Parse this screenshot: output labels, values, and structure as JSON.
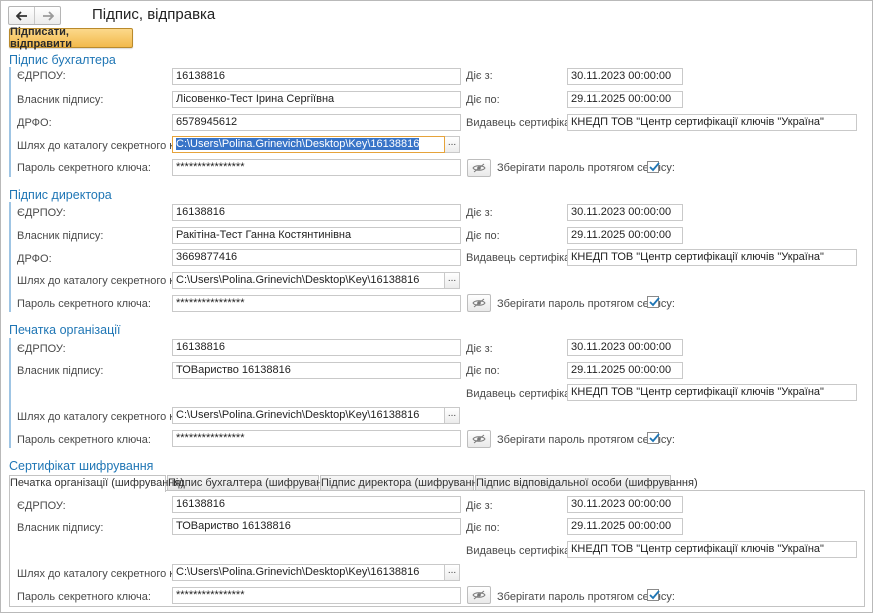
{
  "window": {
    "title": "Підпис, відправка"
  },
  "toolbar": {
    "sign_send_label": "Підписати, відправити"
  },
  "labels": {
    "edrpou": "ЄДРПОУ:",
    "owner": "Власник підпису:",
    "drfo": "ДРФО:",
    "key_path": "Шлях до каталогу секретного ключа:",
    "password": "Пароль секретного ключа:",
    "valid_from": "Діє з:",
    "valid_to": "Діє по:",
    "issuer": "Видавець сертифіката:",
    "save_password": "Зберігати пароль протягом сеансу:",
    "choose": "..."
  },
  "accountant": {
    "title": "Підпис бухгалтера",
    "edrpou": "16138816",
    "owner": "Лісовенко-Тест Ірина Сергіївна",
    "drfo": "6578945612",
    "key_path": "C:\\Users\\Polina.Grinevich\\Desktop\\Key\\16138816",
    "password": "****************",
    "valid_from": "30.11.2023 00:00:00",
    "valid_to": "29.11.2025 00:00:00",
    "issuer": "КНЕДП ТОВ \"Центр сертифікації ключів \"Україна\"",
    "save_password": true
  },
  "director": {
    "title": "Підпис директора",
    "edrpou": "16138816",
    "owner": "Ракітіна-Тест Ганна Костянтинівна",
    "drfo": "3669877416",
    "key_path": "C:\\Users\\Polina.Grinevich\\Desktop\\Key\\16138816",
    "password": "****************",
    "valid_from": "30.11.2023 00:00:00",
    "valid_to": "29.11.2025 00:00:00",
    "issuer": "КНЕДП ТОВ \"Центр сертифікації ключів \"Україна\"",
    "save_password": true
  },
  "stamp": {
    "title": "Печатка організації",
    "edrpou": "16138816",
    "owner": "ТОВариство 16138816",
    "key_path": "C:\\Users\\Polina.Grinevich\\Desktop\\Key\\16138816",
    "password": "****************",
    "valid_from": "30.11.2023 00:00:00",
    "valid_to": "29.11.2025 00:00:00",
    "issuer": "КНЕДП ТОВ \"Центр сертифікації ключів \"Україна\"",
    "save_password": true
  },
  "encryption": {
    "title": "Сертифікат шифрування",
    "tabs": [
      {
        "label": "Печатка організації (шифрування)",
        "active": true
      },
      {
        "label": "Підпис бухгалтера (шифрування)",
        "active": false
      },
      {
        "label": "Підпис директора (шифрування)",
        "active": false
      },
      {
        "label": "Підпис відповідальної особи (шифрування)",
        "active": false
      }
    ],
    "edrpou": "16138816",
    "owner": "ТОВариство 16138816",
    "key_path": "C:\\Users\\Polina.Grinevich\\Desktop\\Key\\16138816",
    "password": "****************",
    "valid_from": "30.11.2023 00:00:00",
    "valid_to": "29.11.2025 00:00:00",
    "issuer": "КНЕДП ТОВ \"Центр сертифікації ключів \"Україна\"",
    "save_password": true
  },
  "icons": {
    "back": "arrow-left-icon",
    "forward": "arrow-right-icon",
    "show_password": "eye-hidden-icon",
    "checked": "checkmark-icon"
  },
  "colors": {
    "accent": "#1f76b5",
    "primary_button": "#f2b94b",
    "selection": "#3874c8",
    "check": "#1f76b5"
  }
}
